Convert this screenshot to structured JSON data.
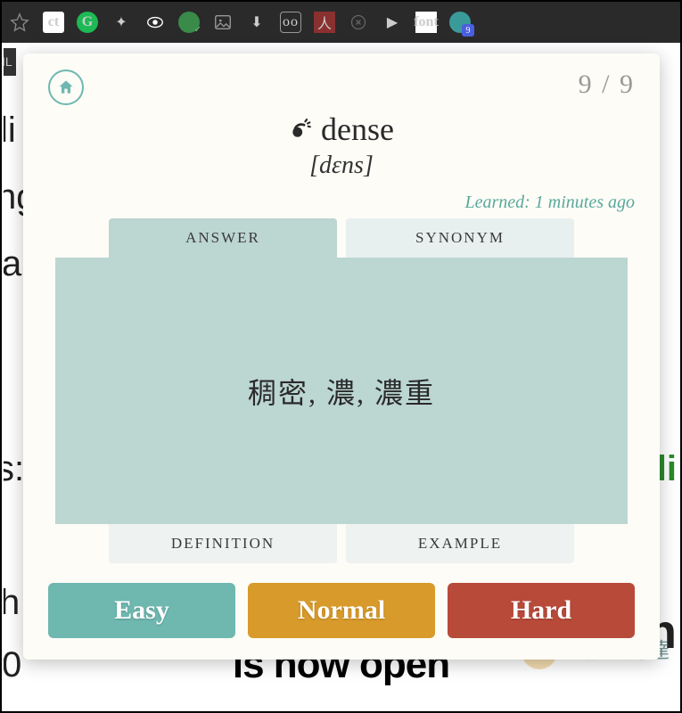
{
  "counter": "9 / 9",
  "word": "dense",
  "phonetic": "[dɛns]",
  "learned": "Learned: 1 minutes ago",
  "tabs": {
    "answer": "ANSWER",
    "synonym": "SYNONYM",
    "definition": "DEFINITION",
    "example": "EXAMPLE"
  },
  "answer_text": "稠密, 濃, 濃重",
  "difficulty": {
    "easy": "Easy",
    "normal": "Normal",
    "hard": "Hard"
  },
  "background": {
    "frag1": "IL",
    "frag2": "li",
    "frag3": "ng",
    "frag4": "a",
    "frag5": "s:",
    "frag6": "li",
    "frag7": "h",
    "frag8": "0",
    "frag9": "n",
    "bottom": "is now open"
  },
  "watermark": "電腦王阿達",
  "badge_count": "9"
}
